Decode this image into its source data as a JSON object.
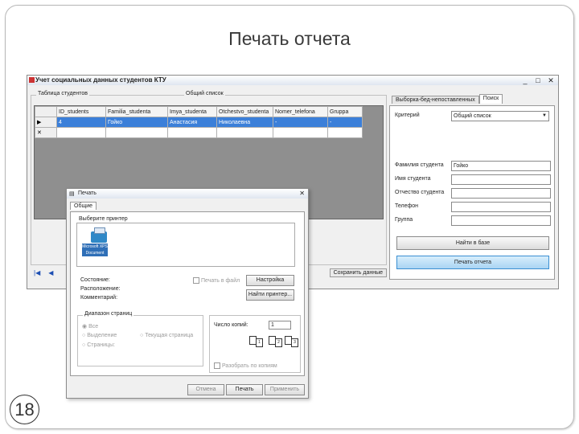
{
  "slide": {
    "title": "Печать отчета",
    "page_number": "18"
  },
  "main_window": {
    "title": "Учет социальных данных студентов КТУ",
    "controls": [
      "_",
      "□",
      "✕"
    ],
    "table_group_label": "Таблица студентов",
    "general_list_label": "Общий список",
    "grid": {
      "columns": [
        "ID_students",
        "Familia_studenta",
        "Imya_studenta",
        "Otchestvo_studenta",
        "Nomer_telefona",
        "Gruppa"
      ],
      "rows": [
        [
          "▶",
          "4",
          "Гойко",
          "Анастасия",
          "Николаевна",
          "-",
          "-"
        ]
      ],
      "new_row_marker": "✕"
    },
    "nav": {
      "first": "|◀",
      "prev": "◀",
      "save_button": "Сохранить данные"
    },
    "tabs": {
      "left": "Выборка-бед-непоставленных",
      "right": "Поиск"
    },
    "search": {
      "criterion_label": "Критерий",
      "criterion_value": "Общий список",
      "fields": [
        {
          "label": "Фамилия студента",
          "value": "Гойко"
        },
        {
          "label": "Имя студента",
          "value": ""
        },
        {
          "label": "Отчество студента",
          "value": ""
        },
        {
          "label": "Телефон",
          "value": ""
        },
        {
          "label": "Группа",
          "value": ""
        }
      ],
      "find_button": "Найти в базе",
      "print_button": "Печать отчета"
    }
  },
  "print_dialog": {
    "title": "Печать",
    "tab": "Общие",
    "select_printer_label": "Выберите принтер",
    "printer_name": "Microsoft XPS Document Writer",
    "status_label": "Состояние:",
    "location_label": "Расположение:",
    "comment_label": "Комментарий:",
    "print_to_file_label": "Печать в файл",
    "settings_button": "Настройка",
    "find_printer_button": "Найти принтер...",
    "page_range_label": "Диапазон страниц",
    "range_all": "Все",
    "range_selection": "Выделение",
    "range_current": "Текущая страница",
    "range_pages": "Страницы:",
    "copies_label": "Число копий:",
    "copies_value": "1",
    "collate_label": "Разобрать по копиям",
    "pages": [
      "1",
      "2",
      "3"
    ],
    "buttons": {
      "print": "Печать",
      "cancel": "Отмена",
      "apply": "Применить"
    }
  }
}
